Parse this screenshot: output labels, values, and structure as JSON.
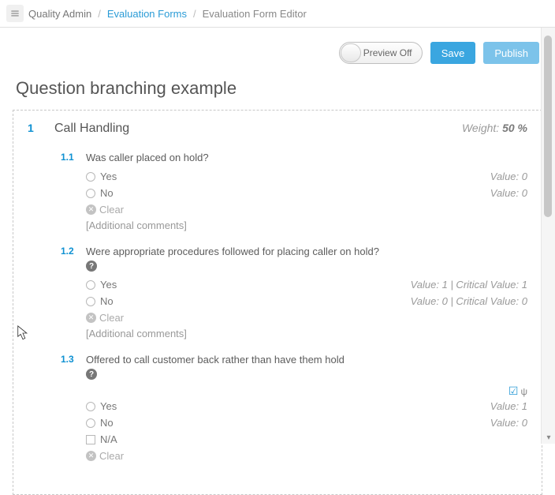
{
  "breadcrumb": {
    "root": "Quality Admin",
    "link": "Evaluation Forms",
    "current": "Evaluation Form Editor"
  },
  "toolbar": {
    "preview_toggle": "Preview Off",
    "save": "Save",
    "publish": "Publish"
  },
  "page_title": "Question branching example",
  "section": {
    "number": "1",
    "title": "Call Handling",
    "weight_label": "Weight:",
    "weight_value": "50 %"
  },
  "questions": [
    {
      "num": "1.1",
      "text": "Was caller placed on hold?",
      "help": false,
      "options": [
        {
          "type": "radio",
          "label": "Yes",
          "value_text": "Value: 0"
        },
        {
          "type": "radio",
          "label": "No",
          "value_text": "Value: 0"
        }
      ],
      "clear": "Clear",
      "additional": "[Additional comments]",
      "branch_flag": false
    },
    {
      "num": "1.2",
      "text": "Were appropriate procedures followed for placing caller on hold?",
      "help": true,
      "options": [
        {
          "type": "radio",
          "label": "Yes",
          "value_text": "Value: 1 | Critical Value: 1"
        },
        {
          "type": "radio",
          "label": "No",
          "value_text": "Value: 0 | Critical Value: 0"
        }
      ],
      "clear": "Clear",
      "additional": "[Additional comments]",
      "branch_flag": false
    },
    {
      "num": "1.3",
      "text": "Offered to call customer back rather than have them hold",
      "help": true,
      "options": [
        {
          "type": "radio",
          "label": "Yes",
          "value_text": "Value: 1"
        },
        {
          "type": "radio",
          "label": "No",
          "value_text": "Value: 0"
        },
        {
          "type": "checkbox",
          "label": "N/A",
          "value_text": ""
        }
      ],
      "clear": "Clear",
      "additional": "",
      "branch_flag": true,
      "branch_flag_text": "ψ"
    }
  ]
}
